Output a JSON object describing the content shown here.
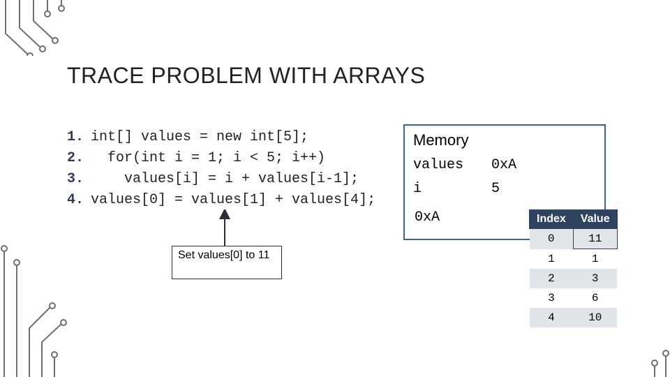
{
  "title": "TRACE PROBLEM WITH ARRAYS",
  "code": {
    "l1": {
      "n": "1.",
      "t": "int[] values = new int[5];"
    },
    "l2": {
      "n": "2.",
      "t": "  for(int i = 1; i < 5; i++)"
    },
    "l3": {
      "n": "3.",
      "t": "    values[i] = i + values[i-1];"
    },
    "l4": {
      "n": "4.",
      "t": "values[0] = values[1] + values[4];"
    }
  },
  "callout": "Set values[0] to 11",
  "memory": {
    "title": "Memory",
    "rows": [
      {
        "k": "values",
        "v": "0xA"
      },
      {
        "k": "i",
        "v": "5"
      }
    ],
    "array_addr": "0xA"
  },
  "table": {
    "headers": [
      "Index",
      "Value"
    ],
    "rows": [
      {
        "i": "0",
        "v": "11",
        "hl": true
      },
      {
        "i": "1",
        "v": "1"
      },
      {
        "i": "2",
        "v": "3"
      },
      {
        "i": "3",
        "v": "6"
      },
      {
        "i": "4",
        "v": "10"
      }
    ]
  }
}
